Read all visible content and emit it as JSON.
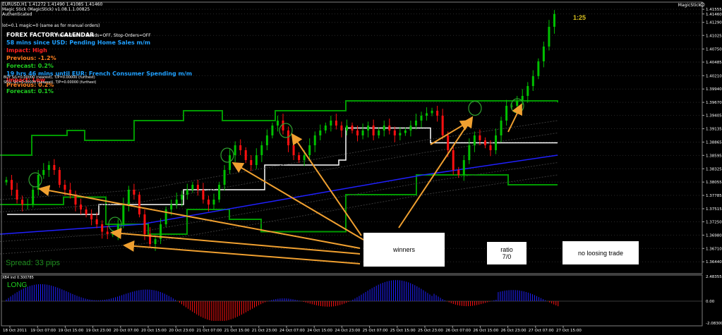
{
  "header": {
    "symbol_line": "EURUSD,H1  1.41272 1.41490 1.41085 1.41460",
    "ea_line": "Magic Stick  (MagicStick)   v1.08.1.1.00825",
    "auth": "Authenticated",
    "lot_line": "lot=0.1   magic=0 (same as for manual orders)",
    "mode_line": "News-Trade...   Bands=OFF,  Stop-Orders=OFF",
    "ea_name": "MagicStick"
  },
  "news": {
    "title": "FOREX FACTORY CALENDAR",
    "event1": "58 mins since USD: Pending Home Sales m/m",
    "event1_impact": "Impact: High",
    "event1_previous": "Previous: -1.2%",
    "event1_forecast": "Forecast: 0.2%",
    "event2": "19 hrs 46 mins until EUR: French Consumer Spending m/m",
    "event2_impact": "Impact: Low",
    "event2_previous": "Previous: 0.2%",
    "event2_forecast": "Forecast: 0.1%",
    "buy_line": "BUY     S/L=0.00000 (nearest),  T/P=0.00000 (furthest)",
    "sell_line": "SELL    S/L=0.00000 (nearest),  T/P=0.00000 (furthest)"
  },
  "overlay": {
    "spread": "Spread: 33 pips",
    "timer": "1:25",
    "winners": "winners",
    "ratio_label": "ratio",
    "ratio_value": "7/0",
    "no_loss": "no loosing trade"
  },
  "indicator": {
    "title": "XB4 ind 0.300785",
    "signal": "LONG",
    "ticks": [
      "2.483554",
      "0.00",
      "-2.083001"
    ]
  },
  "colors": {
    "bull": "#00c000",
    "bear": "#ff1010",
    "channel": "#009a00",
    "midline": "#ffffff",
    "ma": "#2020ff",
    "arrow": "#f0a030",
    "indicator_pos": "#2020ff",
    "indicator_neg": "#ff1010",
    "news_title": "#ffffff",
    "news_event": "#20a0ff",
    "impact_high": "#ff2020",
    "previous": "#ff8020",
    "forecast": "#20d020"
  },
  "chart_data": {
    "type": "candlestick",
    "symbol": "EURUSD",
    "timeframe": "H1",
    "ylim": [
      1.362,
      1.417
    ],
    "y_ticks": [
      "1.41555",
      "1.41460",
      "1.41290",
      "1.41025",
      "1.40750",
      "1.40485",
      "1.40210",
      "1.39940",
      "1.39670",
      "1.39405",
      "1.39135",
      "1.38865",
      "1.38595",
      "1.38325",
      "1.38055",
      "1.37785",
      "1.37515",
      "1.37250",
      "1.36980",
      "1.36710",
      "1.36440"
    ],
    "x_ticks": [
      "18 Oct 2011",
      "19 Oct 07:00",
      "19 Oct 15:00",
      "19 Oct 23:00",
      "20 Oct 07:00",
      "20 Oct 15:00",
      "20 Oct 23:00",
      "21 Oct 07:00",
      "21 Oct 15:00",
      "21 Oct 23:00",
      "24 Oct 07:00",
      "24 Oct 15:00",
      "24 Oct 23:00",
      "25 Oct 07:00",
      "25 Oct 15:00",
      "25 Oct 23:00",
      "26 Oct 07:00",
      "26 Oct 15:00",
      "26 Oct 23:00",
      "27 Oct 07:00",
      "27 Oct 15:00"
    ],
    "close_path": [
      1.381,
      1.379,
      1.377,
      1.376,
      1.376,
      1.379,
      1.382,
      1.383,
      1.384,
      1.383,
      1.38,
      1.379,
      1.378,
      1.376,
      1.375,
      1.374,
      1.373,
      1.372,
      1.3705,
      1.37,
      1.37,
      1.372,
      1.376,
      1.379,
      1.378,
      1.374,
      1.37,
      1.368,
      1.369,
      1.372,
      1.375,
      1.376,
      1.377,
      1.378,
      1.379,
      1.38,
      1.379,
      1.377,
      1.376,
      1.377,
      1.38,
      1.383,
      1.386,
      1.388,
      1.387,
      1.385,
      1.384,
      1.386,
      1.388,
      1.39,
      1.392,
      1.393,
      1.391,
      1.388,
      1.386,
      1.385,
      1.386,
      1.388,
      1.39,
      1.391,
      1.392,
      1.393,
      1.392,
      1.391,
      1.392,
      1.391,
      1.39,
      1.391,
      1.392,
      1.39,
      1.391,
      1.392,
      1.391,
      1.39,
      1.3905,
      1.391,
      1.392,
      1.393,
      1.394,
      1.3945,
      1.395,
      1.394,
      1.39,
      1.387,
      1.383,
      1.382,
      1.385,
      1.388,
      1.39,
      1.389,
      1.388,
      1.387,
      1.39,
      1.393,
      1.396,
      1.396,
      1.397,
      1.398,
      1.4,
      1.402,
      1.405,
      1.408,
      1.412,
      1.4146
    ],
    "upper_channel": [
      [
        0,
        1.386
      ],
      [
        45,
        1.39
      ],
      [
        95,
        1.391
      ],
      [
        120,
        1.389
      ],
      [
        190,
        1.393
      ],
      [
        260,
        1.395
      ],
      [
        315,
        1.393
      ],
      [
        390,
        1.395
      ],
      [
        490,
        1.397
      ],
      [
        720,
        1.397
      ],
      [
        790,
        1.3967
      ]
    ],
    "lower_channel": [
      [
        0,
        1.376
      ],
      [
        90,
        1.3775
      ],
      [
        150,
        1.372
      ],
      [
        210,
        1.37
      ],
      [
        265,
        1.375
      ],
      [
        325,
        1.373
      ],
      [
        370,
        1.3705
      ],
      [
        490,
        1.378
      ],
      [
        590,
        1.382
      ],
      [
        720,
        1.38
      ],
      [
        790,
        1.38
      ]
    ],
    "mid_line": [
      [
        10,
        1.374
      ],
      [
        120,
        1.374
      ],
      [
        140,
        1.376
      ],
      [
        250,
        1.376
      ],
      [
        260,
        1.379
      ],
      [
        365,
        1.379
      ],
      [
        375,
        1.384
      ],
      [
        480,
        1.385
      ],
      [
        490,
        1.3915
      ],
      [
        600,
        1.3915
      ],
      [
        610,
        1.3885
      ],
      [
        790,
        1.3885
      ]
    ],
    "moving_average": [
      [
        0,
        1.37
      ],
      [
        200,
        1.372
      ],
      [
        400,
        1.377
      ],
      [
        600,
        1.382
      ],
      [
        790,
        1.386
      ]
    ],
    "win_circles": [
      [
        50,
        1.381
      ],
      [
        163,
        1.372
      ],
      [
        322,
        1.386
      ],
      [
        405,
        1.391
      ],
      [
        673,
        1.3955
      ],
      [
        733,
        1.396
      ]
    ]
  }
}
